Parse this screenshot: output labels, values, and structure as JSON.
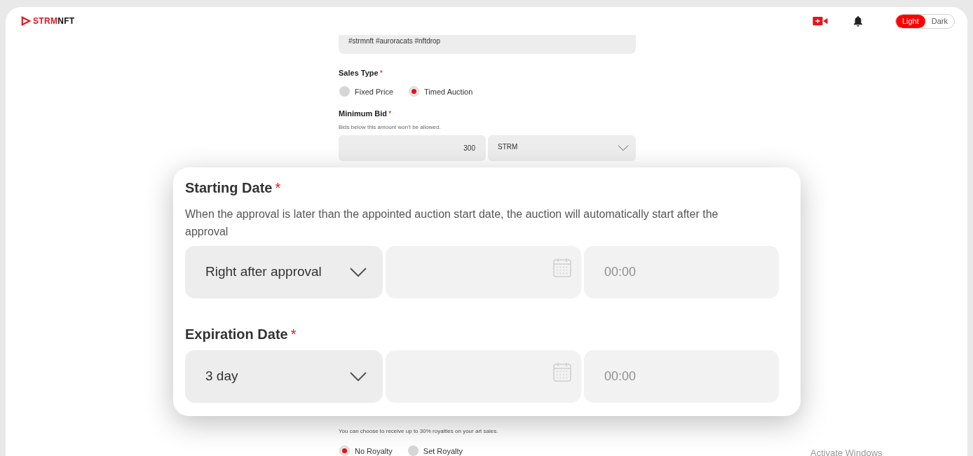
{
  "header": {
    "logo": {
      "part_1": "STRM",
      "part_2": "NFT"
    },
    "theme_toggle": [
      {
        "label": "Light",
        "selected": true
      },
      {
        "label": "Dark",
        "selected": false
      }
    ]
  },
  "form": {
    "tags_value": "#strmnft #auroracats #nftdrop",
    "sales_type": {
      "label": "Sales Type",
      "required_mark": "*",
      "options": [
        {
          "label": "Fixed Price",
          "selected": false
        },
        {
          "label": "Timed Auction",
          "selected": true
        }
      ]
    },
    "minimum_bid": {
      "label": "Minimum Bid",
      "required_mark": "*",
      "hint": "Bids below this amount won't be allowed.",
      "value": "300",
      "currency": "STRM"
    },
    "royalty": {
      "hint": "You can choose to receive up to 30% royalties on your art sales.",
      "options": [
        {
          "label": "No Royalty",
          "selected": true
        },
        {
          "label": "Set Royalty",
          "selected": false
        }
      ]
    }
  },
  "dialog": {
    "sections": [
      {
        "title": "Starting Date",
        "required_mark": "*",
        "description": "When the approval is later than the appointed auction start date, the auction will automatically start after the approval",
        "select": "Right after approval",
        "time_placeholder": "00:00"
      },
      {
        "title": "Expiration Date",
        "required_mark": "*",
        "select": "3 day",
        "time_placeholder": "00:00"
      }
    ]
  },
  "system_notice": "Activate Windows"
}
